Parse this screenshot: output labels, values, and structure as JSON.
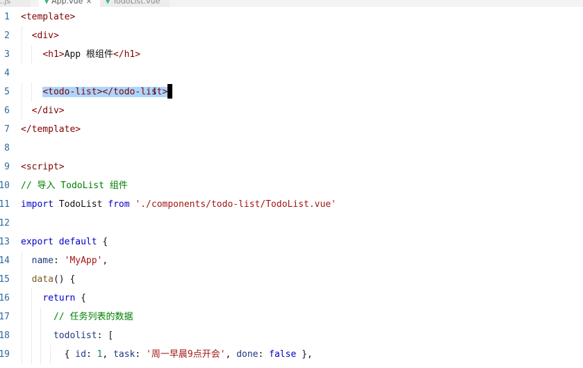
{
  "tabs": [
    {
      "label": "...js"
    },
    {
      "label": "App.vue",
      "close": "×"
    },
    {
      "label": "TodoList.vue"
    }
  ],
  "editor": {
    "lines": [
      {
        "n": "1",
        "parts": [
          [
            "tag",
            "<template>"
          ]
        ]
      },
      {
        "n": "2",
        "parts": [
          [
            "sp",
            "  "
          ],
          [
            "tag",
            "<div>"
          ]
        ]
      },
      {
        "n": "3",
        "parts": [
          [
            "sp",
            "    "
          ],
          [
            "tag",
            "<h1>"
          ],
          [
            "plain",
            "App 根组件"
          ],
          [
            "tag",
            "</h1>"
          ]
        ]
      },
      {
        "n": "4",
        "parts": []
      },
      {
        "n": "5",
        "parts": [
          [
            "sp",
            "    "
          ],
          [
            "sel",
            "<todo-list></todo-list>"
          ]
        ]
      },
      {
        "n": "6",
        "parts": [
          [
            "sp",
            "  "
          ],
          [
            "tag",
            "</div>"
          ]
        ]
      },
      {
        "n": "7",
        "parts": [
          [
            "tag",
            "</template>"
          ]
        ]
      },
      {
        "n": "8",
        "parts": []
      },
      {
        "n": "9",
        "parts": [
          [
            "tag",
            "<script>"
          ]
        ]
      },
      {
        "n": "10",
        "parts": [
          [
            "cmt",
            "// 导入 TodoList 组件"
          ]
        ]
      },
      {
        "n": "11",
        "parts": [
          [
            "kw",
            "import"
          ],
          [
            "plain",
            " TodoList "
          ],
          [
            "kw",
            "from"
          ],
          [
            "plain",
            " "
          ],
          [
            "str",
            "'./components/todo-list/TodoList.vue'"
          ]
        ]
      },
      {
        "n": "12",
        "parts": []
      },
      {
        "n": "13",
        "parts": [
          [
            "kw",
            "export"
          ],
          [
            "plain",
            " "
          ],
          [
            "kw",
            "default"
          ],
          [
            "plain",
            " {"
          ]
        ]
      },
      {
        "n": "14",
        "parts": [
          [
            "sp",
            "  "
          ],
          [
            "prop",
            "name"
          ],
          [
            "plain",
            ": "
          ],
          [
            "str",
            "'MyApp'"
          ],
          [
            "plain",
            ","
          ]
        ]
      },
      {
        "n": "15",
        "parts": [
          [
            "sp",
            "  "
          ],
          [
            "fn",
            "data"
          ],
          [
            "plain",
            "() {"
          ]
        ]
      },
      {
        "n": "16",
        "parts": [
          [
            "sp",
            "    "
          ],
          [
            "kw",
            "return"
          ],
          [
            "plain",
            " {"
          ]
        ]
      },
      {
        "n": "17",
        "parts": [
          [
            "sp",
            "      "
          ],
          [
            "cmt",
            "// 任务列表的数据"
          ]
        ]
      },
      {
        "n": "18",
        "parts": [
          [
            "sp",
            "      "
          ],
          [
            "prop",
            "todolist"
          ],
          [
            "plain",
            ": ["
          ]
        ]
      },
      {
        "n": "19",
        "parts": [
          [
            "sp",
            "        "
          ],
          [
            "plain",
            "{ "
          ],
          [
            "prop",
            "id"
          ],
          [
            "plain",
            ": "
          ],
          [
            "num",
            "1"
          ],
          [
            "plain",
            ", "
          ],
          [
            "prop",
            "task"
          ],
          [
            "plain",
            ": "
          ],
          [
            "str",
            "'周一早晨9点开会'"
          ],
          [
            "plain",
            ", "
          ],
          [
            "prop",
            "done"
          ],
          [
            "plain",
            ": "
          ],
          [
            "kw",
            "false"
          ],
          [
            "plain",
            " },"
          ]
        ]
      }
    ]
  },
  "colors": {
    "tag": "#800000",
    "keyword": "#0000c8",
    "string": "#a31515",
    "comment": "#008000",
    "line_number": "#2b6aa0",
    "selection": "#add6ff"
  },
  "icons": {
    "vue_file": "vue-icon",
    "text_cursor": "ibeam-cursor-icon"
  }
}
